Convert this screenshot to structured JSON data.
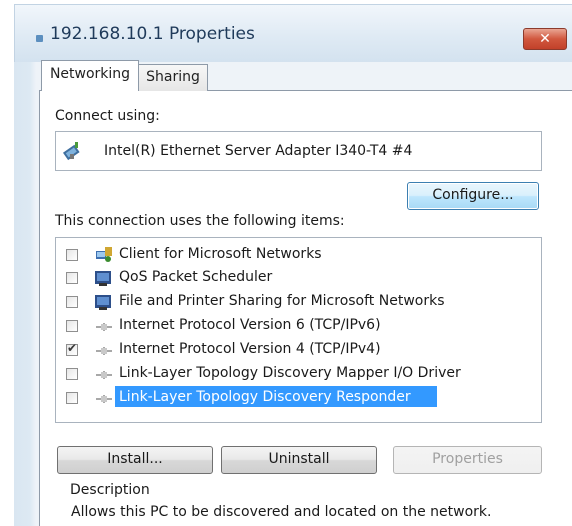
{
  "window": {
    "title": "192.168.10.1 Properties"
  },
  "tabs": [
    {
      "label": "Networking",
      "active": true
    },
    {
      "label": "Sharing",
      "active": false
    }
  ],
  "connect_using": {
    "label": "Connect using:",
    "adapter": "Intel(R) Ethernet Server Adapter I340-T4 #4",
    "adapter_icon": "network-adapter-icon"
  },
  "buttons": {
    "configure": "Configure...",
    "install": "Install...",
    "uninstall": "Uninstall",
    "properties": "Properties"
  },
  "items_label": "This connection uses the following items:",
  "items": [
    {
      "label": "Client for Microsoft Networks",
      "checked": false,
      "icon": "network-client-icon"
    },
    {
      "label": "QoS Packet Scheduler",
      "checked": false,
      "icon": "network-service-icon"
    },
    {
      "label": "File and Printer Sharing for Microsoft Networks",
      "checked": false,
      "icon": "network-service-icon"
    },
    {
      "label": "Internet Protocol Version 6 (TCP/IPv6)",
      "checked": false,
      "icon": "protocol-icon"
    },
    {
      "label": "Internet Protocol Version 4 (TCP/IPv4)",
      "checked": true,
      "icon": "protocol-icon"
    },
    {
      "label": "Link-Layer Topology Discovery Mapper I/O Driver",
      "checked": false,
      "icon": "protocol-icon"
    },
    {
      "label": "Link-Layer Topology Discovery Responder",
      "checked": false,
      "icon": "protocol-icon",
      "selected": true
    }
  ],
  "description": {
    "label": "Description",
    "text": "Allows this PC to be discovered and located on the network."
  },
  "colors": {
    "selection": "#3399ff",
    "close_button": "#c2412a",
    "title_text": "#1f3a5a"
  }
}
